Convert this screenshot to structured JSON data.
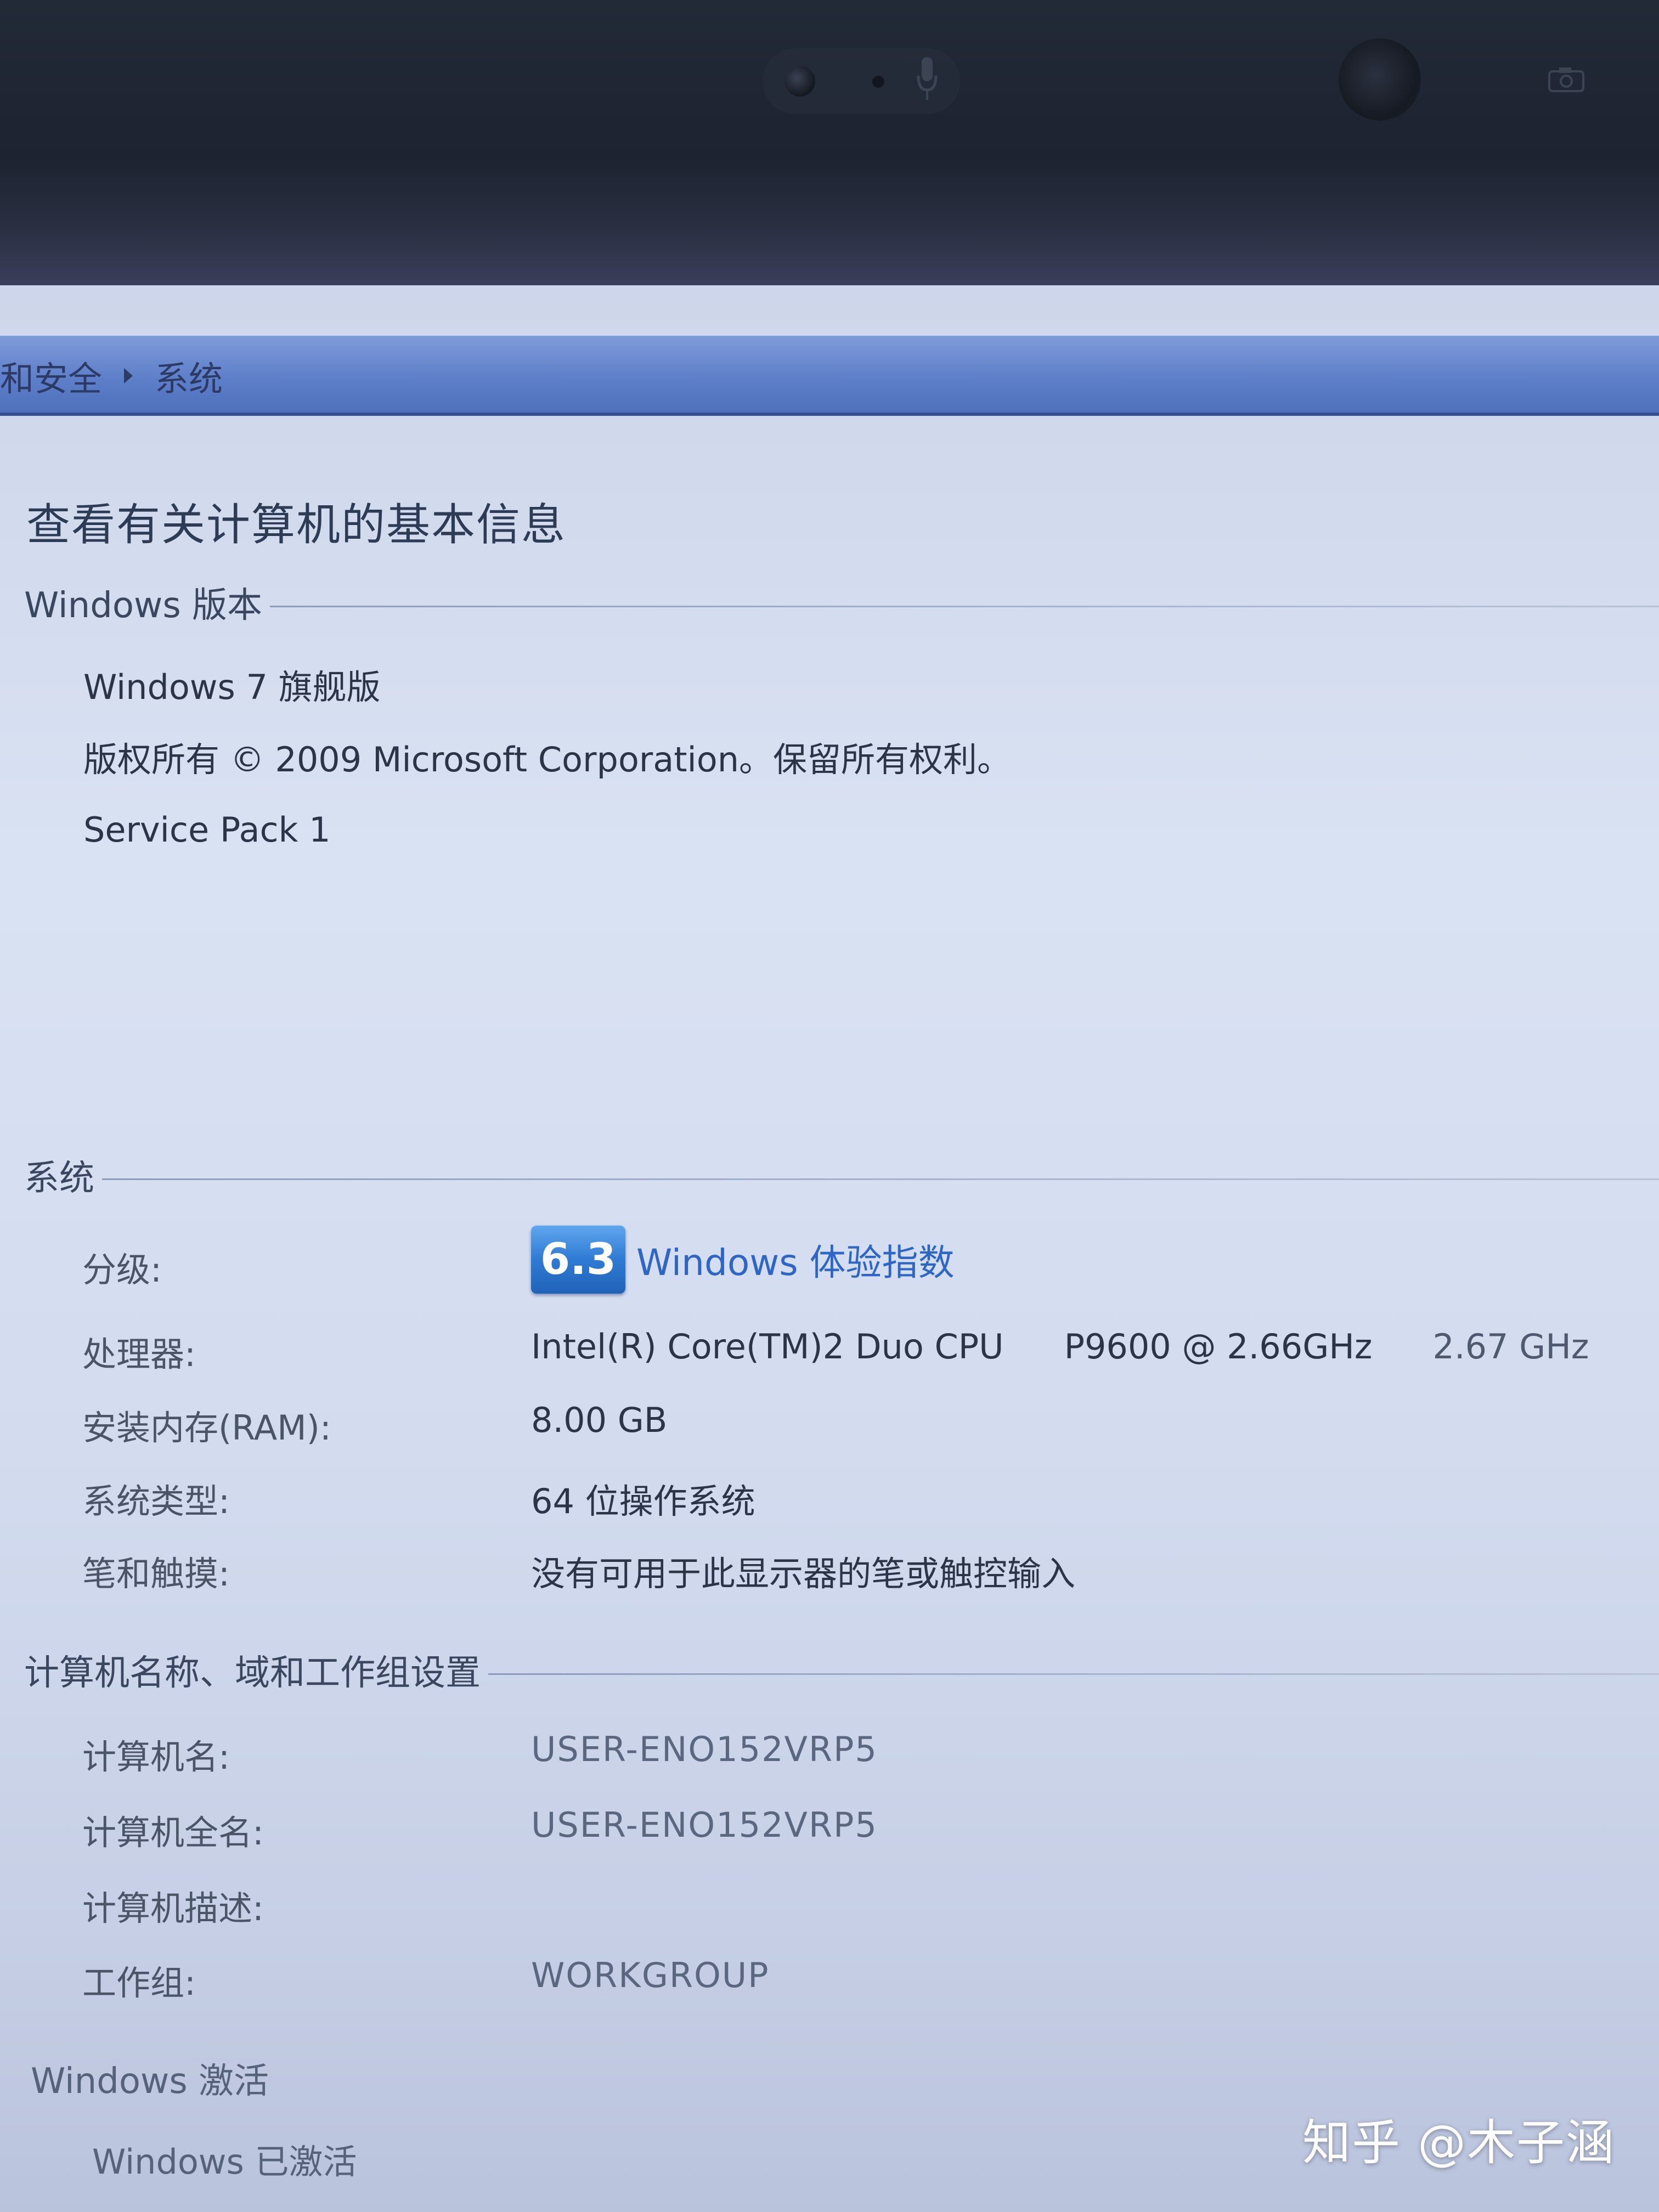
{
  "breadcrumb": {
    "items": [
      "和安全",
      "系统"
    ]
  },
  "page_title": "查看有关计算机的基本信息",
  "windows_edition": {
    "header": "Windows 版本",
    "edition": "Windows 7 旗舰版",
    "copyright": "版权所有 © 2009 Microsoft Corporation。保留所有权利。",
    "service_pack": "Service Pack 1"
  },
  "system": {
    "header": "系统",
    "rating_label": "分级:",
    "rating_score": "6.3",
    "rating_link": "Windows 体验指数",
    "processor_label": "处理器:",
    "processor_name": "Intel(R) Core(TM)2 Duo CPU",
    "processor_model": "P9600  @ 2.66GHz",
    "processor_speed": "2.67 GHz",
    "ram_label": "安装内存(RAM):",
    "ram_value": "8.00 GB",
    "type_label": "系统类型:",
    "type_value": "64 位操作系统",
    "pen_label": "笔和触摸:",
    "pen_value": "没有可用于此显示器的笔或触控输入"
  },
  "computer_name": {
    "header": "计算机名称、域和工作组设置",
    "name_label": "计算机名:",
    "name_value": "USER-ENO152VRP5",
    "full_name_label": "计算机全名:",
    "full_name_value": "USER-ENO152VRP5",
    "description_label": "计算机描述:",
    "description_value": "",
    "workgroup_label": "工作组:",
    "workgroup_value": "WORKGROUP"
  },
  "activation": {
    "header": "Windows 激活",
    "status": "Windows 已激活"
  },
  "watermark": "知乎 @木子涵",
  "icons": {
    "breadcrumb_separator": "chevron-right-icon",
    "microphone": "microphone-icon",
    "camera": "camera-icon"
  },
  "colors": {
    "address_bar": "#5e7fc9",
    "link": "#2d66c7",
    "rating_badge": "#2f7bd4"
  }
}
